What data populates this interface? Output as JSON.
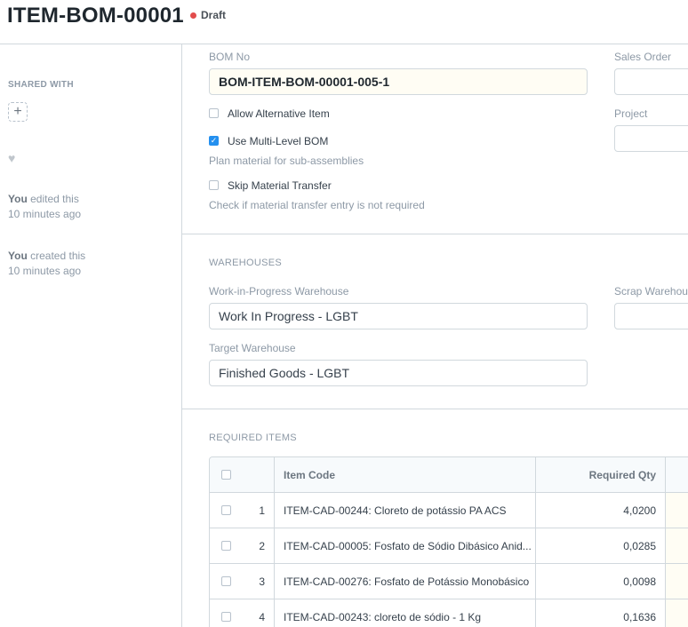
{
  "header": {
    "title": "ITEM-BOM-00001",
    "status": "Draft",
    "status_color": "#e24c4c"
  },
  "sidebar": {
    "shared_with_label": "SHARED WITH",
    "add_symbol": "+",
    "heart_symbol": "♥",
    "activity": [
      {
        "actor": "You",
        "action": "edited this",
        "time": "10 minutes ago"
      },
      {
        "actor": "You",
        "action": "created this",
        "time": "10 minutes ago"
      }
    ]
  },
  "form": {
    "bom_no": {
      "label": "BOM No",
      "value": "BOM-ITEM-BOM-00001-005-1"
    },
    "sales_order": {
      "label": "Sales Order",
      "value": ""
    },
    "project": {
      "label": "Project",
      "value": ""
    },
    "allow_alternative": {
      "label": "Allow Alternative Item",
      "checked": false
    },
    "use_multi_level": {
      "label": "Use Multi-Level BOM",
      "checked": true,
      "description": "Plan material for sub-assemblies"
    },
    "skip_transfer": {
      "label": "Skip Material Transfer",
      "checked": false,
      "description": "Check if material transfer entry is not required"
    }
  },
  "warehouses": {
    "section_label": "WAREHOUSES",
    "wip_label": "Work-in-Progress Warehouse",
    "wip_value": "Work In Progress - LGBT",
    "scrap_label": "Scrap Warehouse",
    "scrap_value": "",
    "target_label": "Target Warehouse",
    "target_value": "Finished Goods - LGBT"
  },
  "required_items": {
    "section_label": "REQUIRED ITEMS",
    "columns": {
      "item_code": "Item Code",
      "required_qty": "Required Qty"
    },
    "rows": [
      {
        "idx": "1",
        "item_code": "ITEM-CAD-00244: Cloreto de potássio PA ACS",
        "qty": "4,0200"
      },
      {
        "idx": "2",
        "item_code": "ITEM-CAD-00005: Fosfato de Sódio Dibásico Anid...",
        "qty": "0,0285"
      },
      {
        "idx": "3",
        "item_code": "ITEM-CAD-00276: Fosfato de Potássio Monobásico",
        "qty": "0,0098"
      },
      {
        "idx": "4",
        "item_code": "ITEM-CAD-00243: cloreto de sódio - 1 Kg",
        "qty": "0,1636"
      }
    ]
  }
}
